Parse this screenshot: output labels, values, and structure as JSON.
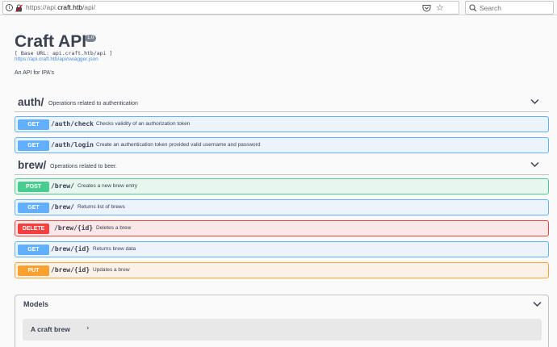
{
  "browser": {
    "url_prefix": "https://api.",
    "url_domain": "craft.htb",
    "url_suffix": "/api/",
    "search_placeholder": "Search",
    "info_glyph": "i",
    "star_glyph": "☆"
  },
  "info": {
    "title": "Craft API",
    "version": "1.0",
    "base_url": "[ Base URL: api.craft.htb/api ]",
    "spec_link": "https://api.craft.htb/api/swagger.json",
    "description": "An API for IPA's"
  },
  "tags": [
    {
      "name": "auth/",
      "description": "Operations related to authentication",
      "operations": [
        {
          "method": "GET",
          "path": "/auth/check",
          "summary": "Checks validity of an authorization token"
        },
        {
          "method": "GET",
          "path": "/auth/login",
          "summary": "Create an authentication token provided valid username and password"
        }
      ]
    },
    {
      "name": "brew/",
      "description": "Operations related to beer.",
      "operations": [
        {
          "method": "POST",
          "path": "/brew/",
          "summary": "Creates a new brew entry"
        },
        {
          "method": "GET",
          "path": "/brew/",
          "summary": "Returns list of brews"
        },
        {
          "method": "DELETE",
          "path": "/brew/{id}",
          "summary": "Deletes a brew"
        },
        {
          "method": "GET",
          "path": "/brew/{id}",
          "summary": "Returns brew data"
        },
        {
          "method": "PUT",
          "path": "/brew/{id}",
          "summary": "Updates a brew"
        }
      ]
    }
  ],
  "models": {
    "title": "Models",
    "items": [
      {
        "name": "A craft brew",
        "arrow": "›"
      }
    ]
  },
  "colors": {
    "get": "#61affe",
    "post": "#49cc90",
    "delete": "#f93e3e",
    "put": "#fca130",
    "text": "#3b4151",
    "link": "#4990e2"
  }
}
